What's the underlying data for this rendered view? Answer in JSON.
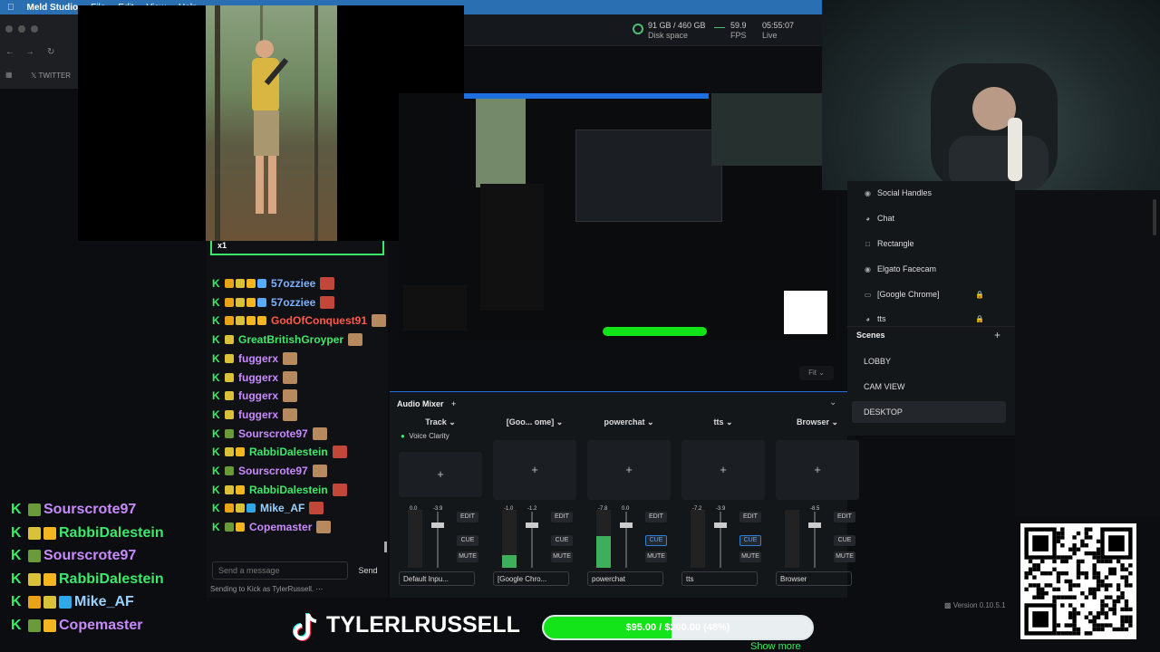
{
  "menubar": {
    "app": "Meld Studio",
    "items": [
      "File",
      "Edit",
      "View",
      "Help"
    ]
  },
  "status": {
    "disk": "91 GB / 460 GB",
    "disk_label": "Disk space",
    "fps": "59.9",
    "fps_label": "FPS",
    "time": "05:55:07",
    "live_label": "Live"
  },
  "browser": {
    "tab_label": "TWITTER"
  },
  "sources": {
    "items": [
      {
        "label": "Social Handles",
        "icon": "eye-icon"
      },
      {
        "label": "Chat",
        "icon": "browser-icon"
      },
      {
        "label": "Rectangle",
        "icon": "square-icon"
      },
      {
        "label": "Elgato Facecam",
        "icon": "camera-icon"
      },
      {
        "label": "[Google Chrome]",
        "icon": "window-icon",
        "locked": true
      },
      {
        "label": "tts",
        "icon": "browser-icon",
        "locked": true
      }
    ]
  },
  "scenes": {
    "title": "Scenes",
    "items": [
      "LOBBY",
      "CAM VIEW",
      "DESKTOP"
    ],
    "active": "DESKTOP"
  },
  "preview": {
    "fit_label": "Fit"
  },
  "chat": {
    "top_label": "x1",
    "messages": [
      {
        "name": "57ozziee",
        "color": "#7fb3ff",
        "badges": [
          "gold",
          "yellow",
          "crown",
          "sword"
        ],
        "emote": "red"
      },
      {
        "name": "57ozziee",
        "color": "#7fb3ff",
        "badges": [
          "gold",
          "yellow",
          "crown",
          "sword"
        ],
        "emote": "red"
      },
      {
        "name": "GodOfConquest91",
        "color": "#ff5a4a",
        "badges": [
          "gold",
          "yellow",
          "crown",
          "crown"
        ],
        "emote": "tan"
      },
      {
        "name": "GreatBritishGroyper",
        "color": "#3ee86b",
        "badges": [
          "yellow"
        ],
        "emote": "tan"
      },
      {
        "name": "fuggerx",
        "color": "#c88bff",
        "badges": [
          "yellow"
        ],
        "emote": "tan"
      },
      {
        "name": "fuggerx",
        "color": "#c88bff",
        "badges": [
          "yellow"
        ],
        "emote": "tan"
      },
      {
        "name": "fuggerx",
        "color": "#c88bff",
        "badges": [
          "yellow"
        ],
        "emote": "tan"
      },
      {
        "name": "fuggerx",
        "color": "#c88bff",
        "badges": [
          "yellow"
        ],
        "emote": "tan"
      },
      {
        "name": "Sourscrote97",
        "color": "#c88bff",
        "badges": [
          "green"
        ],
        "emote": "tan"
      },
      {
        "name": "RabbiDalestein",
        "color": "#3ee86b",
        "badges": [
          "yellow",
          "crown"
        ],
        "emote": "red"
      },
      {
        "name": "Sourscrote97",
        "color": "#c88bff",
        "badges": [
          "green"
        ],
        "emote": "tan"
      },
      {
        "name": "RabbiDalestein",
        "color": "#3ee86b",
        "badges": [
          "yellow",
          "crown"
        ],
        "emote": "red"
      },
      {
        "name": "Mike_AF",
        "color": "#9ad1ff",
        "badges": [
          "gold",
          "yellow",
          "cube"
        ],
        "emote": "red"
      },
      {
        "name": "Copemaster",
        "color": "#c88bff",
        "badges": [
          "green",
          "crown"
        ],
        "emote": "tan"
      }
    ],
    "input_placeholder": "Send a message",
    "send_label": "Send",
    "status": "Sending to Kick as TylerRussell."
  },
  "mixer": {
    "title": "Audio Mixer",
    "strips": [
      {
        "name": "Track",
        "db_left": "0.0",
        "db_right": "-3.9",
        "level": 0.0,
        "cue_active": false,
        "select": "Default Inpu...",
        "select_icon": "",
        "filter": "Voice Clarity"
      },
      {
        "name": "[Goo... ome]",
        "db_left": "-1.0",
        "db_right": "-1.2",
        "level": 0.22,
        "cue_active": false,
        "select": "[Google Chro...",
        "select_icon": "window-icon",
        "filter": ""
      },
      {
        "name": "powerchat",
        "db_left": "-7.8",
        "db_right": "0.0",
        "level": 0.55,
        "cue_active": true,
        "select": "powerchat",
        "select_icon": "browser-icon",
        "filter": ""
      },
      {
        "name": "tts",
        "db_left": "-7.2",
        "db_right": "-3.9",
        "level": 0.0,
        "cue_active": true,
        "select": "tts",
        "select_icon": "browser-icon",
        "filter": ""
      },
      {
        "name": "Browser",
        "db_left": "",
        "db_right": "-8.5",
        "level": 0.0,
        "cue_active": false,
        "select": "Browser",
        "select_icon": "browser-icon",
        "filter": ""
      }
    ],
    "edit_label": "EDIT",
    "cue_label": "CUE",
    "mute_label": "MUTE"
  },
  "overlay": {
    "big_chat": [
      {
        "name": "Sourscrote97",
        "color": "#c88bff",
        "badges": [
          "green"
        ]
      },
      {
        "name": "RabbiDalestein",
        "color": "#3ee86b",
        "badges": [
          "yellow",
          "crown"
        ]
      },
      {
        "name": "Sourscrote97",
        "color": "#c88bff",
        "badges": [
          "green"
        ]
      },
      {
        "name": "RabbiDalestein",
        "color": "#3ee86b",
        "badges": [
          "yellow",
          "crown"
        ]
      },
      {
        "name": "Mike_AF",
        "color": "#9ad1ff",
        "badges": [
          "gold",
          "yellow",
          "cube"
        ]
      },
      {
        "name": "Copemaster",
        "color": "#c88bff",
        "badges": [
          "green",
          "crown"
        ]
      }
    ],
    "handle": "TYLERLRUSSELL",
    "goal_text": "$95.00 / $200.00 (48%)",
    "goal_fraction": 0.475,
    "show_more": "Show more",
    "version": "Version 0.10.5.1"
  },
  "colors": {
    "accent": "#1f6fe0",
    "kick_green": "#3ee86b",
    "goal_green": "#13e319"
  }
}
